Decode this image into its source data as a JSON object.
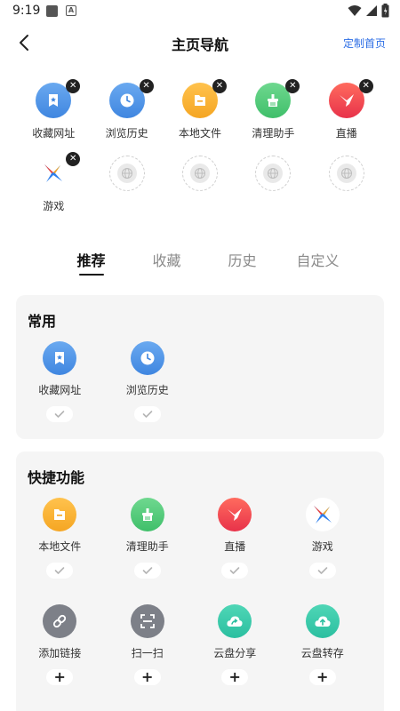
{
  "status_bar": {
    "time": "9:19"
  },
  "header": {
    "title": "主页导航",
    "customize_link": "定制首页"
  },
  "selected": [
    {
      "label": "收藏网址",
      "icon": "bookmark-icon",
      "color": "#4a90e2"
    },
    {
      "label": "浏览历史",
      "icon": "clock-icon",
      "color": "#4a90e2"
    },
    {
      "label": "本地文件",
      "icon": "folder-icon",
      "color": "#f5a623"
    },
    {
      "label": "清理助手",
      "icon": "broom-icon",
      "color": "#3fbf6a"
    },
    {
      "label": "直播",
      "icon": "live-bird-icon",
      "color": "#f0443a"
    },
    {
      "label": "游戏",
      "icon": "game-x-icon",
      "color": "#2f80ed"
    }
  ],
  "tabs": [
    "推荐",
    "收藏",
    "历史",
    "自定义"
  ],
  "active_tab": "推荐",
  "sections": {
    "common": {
      "title": "常用",
      "items": [
        {
          "label": "收藏网址",
          "icon": "bookmark-icon",
          "state": "added"
        },
        {
          "label": "浏览历史",
          "icon": "clock-icon",
          "state": "added"
        }
      ]
    },
    "quick": {
      "title": "快捷功能",
      "items": [
        {
          "label": "本地文件",
          "icon": "folder-icon",
          "state": "added"
        },
        {
          "label": "清理助手",
          "icon": "broom-icon",
          "state": "added"
        },
        {
          "label": "直播",
          "icon": "live-bird-icon",
          "state": "added"
        },
        {
          "label": "游戏",
          "icon": "game-x-icon",
          "state": "added"
        },
        {
          "label": "添加链接",
          "icon": "link-icon",
          "state": "add"
        },
        {
          "label": "扫一扫",
          "icon": "scan-icon",
          "state": "add"
        },
        {
          "label": "云盘分享",
          "icon": "cloud-share-icon",
          "state": "add"
        },
        {
          "label": "云盘转存",
          "icon": "cloud-save-icon",
          "state": "add"
        }
      ]
    }
  },
  "colors": {
    "accent_blue": "#2b6de5",
    "bookmark": "#4a90e2",
    "folder": "#f5a623",
    "broom": "#3fbf6a",
    "live": "#f0443a",
    "gray_icon": "#7d8088",
    "teal_icon": "#2bbfa0"
  }
}
